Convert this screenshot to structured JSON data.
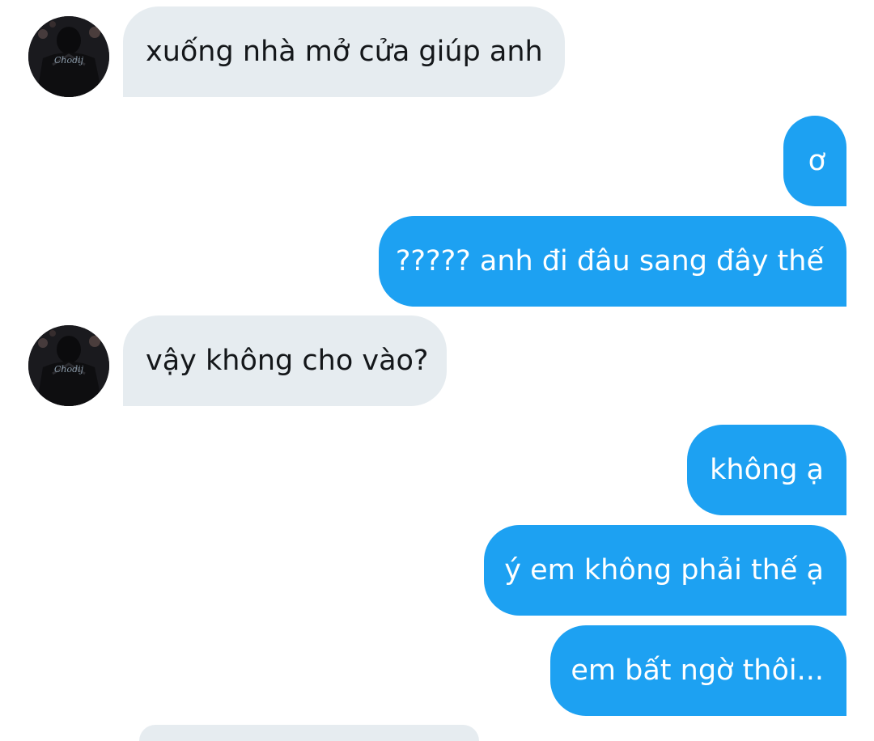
{
  "conversation": {
    "messages": [
      {
        "sender": "other",
        "text": "xuống nhà mở cửa giúp anh"
      },
      {
        "sender": "me",
        "text": "ơ"
      },
      {
        "sender": "me",
        "text": "????? anh đi đâu sang đây thế"
      },
      {
        "sender": "other",
        "text": "vậy không cho vào?"
      },
      {
        "sender": "me",
        "text": "không ạ"
      },
      {
        "sender": "me",
        "text": "ý em không phải thế ạ"
      },
      {
        "sender": "me",
        "text": "em bất ngờ thôi..."
      }
    ]
  },
  "avatar": {
    "icon": "user-photo-avatar",
    "shirt_print": "Chodij"
  },
  "colors": {
    "incoming_bubble": "#e6ecf0",
    "incoming_text": "#14171a",
    "outgoing_bubble": "#1da1f2",
    "outgoing_text": "#ffffff",
    "background": "#ffffff"
  }
}
